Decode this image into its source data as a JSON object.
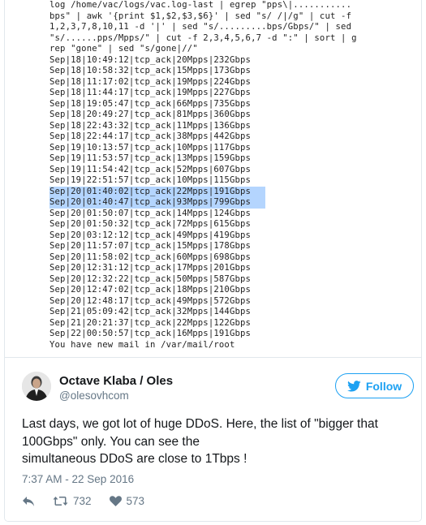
{
  "terminal": {
    "command_lines": [
      "log /home/vac/logs/vac.log-last | egrep \"pps\\|...........",
      "bps\" | awk '{print $1,$2,$3,$6}' | sed \"s/ /|/g\" | cut -f",
      "1,2,3,7,8,10,11 -d '|' | sed \"s/.........bps/Gbps/\" | sed",
      "\"s/......pps/Mpps/\" | cut -f 2,3,4,5,6,7 -d \":\" | sort | g",
      "rep \"gone\" | sed \"s/gone|//\""
    ],
    "rows": [
      {
        "text": "Sep|18|10:49:12|tcp_ack|20Mpps|232Gbps",
        "highlighted": false
      },
      {
        "text": "Sep|18|10:58:32|tcp_ack|15Mpps|173Gbps",
        "highlighted": false
      },
      {
        "text": "Sep|18|11:17:02|tcp_ack|19Mpps|224Gbps",
        "highlighted": false
      },
      {
        "text": "Sep|18|11:44:17|tcp_ack|19Mpps|227Gbps",
        "highlighted": false
      },
      {
        "text": "Sep|18|19:05:47|tcp_ack|66Mpps|735Gbps",
        "highlighted": false
      },
      {
        "text": "Sep|18|20:49:27|tcp_ack|81Mpps|360Gbps",
        "highlighted": false
      },
      {
        "text": "Sep|18|22:43:32|tcp_ack|11Mpps|136Gbps",
        "highlighted": false
      },
      {
        "text": "Sep|18|22:44:17|tcp_ack|38Mpps|442Gbps",
        "highlighted": false
      },
      {
        "text": "Sep|19|10:13:57|tcp_ack|10Mpps|117Gbps",
        "highlighted": false
      },
      {
        "text": "Sep|19|11:53:57|tcp_ack|13Mpps|159Gbps",
        "highlighted": false
      },
      {
        "text": "Sep|19|11:54:42|tcp_ack|52Mpps|607Gbps",
        "highlighted": false
      },
      {
        "text": "Sep|19|22:51:57|tcp_ack|10Mpps|115Gbps",
        "highlighted": false
      },
      {
        "text": "Sep|20|01:40:02|tcp_ack|22Mpps|191Gbps",
        "highlighted": true
      },
      {
        "text": "Sep|20|01:40:47|tcp_ack|93Mpps|799Gbps",
        "highlighted": true
      },
      {
        "text": "Sep|20|01:50:07|tcp_ack|14Mpps|124Gbps",
        "highlighted": false
      },
      {
        "text": "Sep|20|01:50:32|tcp_ack|72Mpps|615Gbps",
        "highlighted": false
      },
      {
        "text": "Sep|20|03:12:12|tcp_ack|49Mpps|419Gbps",
        "highlighted": false
      },
      {
        "text": "Sep|20|11:57:07|tcp_ack|15Mpps|178Gbps",
        "highlighted": false
      },
      {
        "text": "Sep|20|11:58:02|tcp_ack|60Mpps|698Gbps",
        "highlighted": false
      },
      {
        "text": "Sep|20|12:31:12|tcp_ack|17Mpps|201Gbps",
        "highlighted": false
      },
      {
        "text": "Sep|20|12:32:22|tcp_ack|50Mpps|587Gbps",
        "highlighted": false
      },
      {
        "text": "Sep|20|12:47:02|tcp_ack|18Mpps|210Gbps",
        "highlighted": false
      },
      {
        "text": "Sep|20|12:48:17|tcp_ack|49Mpps|572Gbps",
        "highlighted": false
      },
      {
        "text": "Sep|21|05:09:42|tcp_ack|32Mpps|144Gbps",
        "highlighted": false
      },
      {
        "text": "Sep|21|20:21:37|tcp_ack|22Mpps|122Gbps",
        "highlighted": false
      },
      {
        "text": "Sep|22|00:50:57|tcp_ack|16Mpps|191Gbps",
        "highlighted": false
      }
    ],
    "footer_line": "You have new mail in /var/mail/root",
    "highlight_color": "#b4d5fe"
  },
  "tweet": {
    "author_name": "Octave Klaba / Oles",
    "author_handle": "@olesovhcom",
    "follow_label": "Follow",
    "text_lines": [
      "Last days, we got lot of huge DDoS. Here, the list of \"bigger that",
      "100Gbps\" only. You can see the",
      "simultaneous DDoS are close to 1Tbps !"
    ],
    "timestamp": "7:37 AM - 22 Sep 2016",
    "retweet_count": "732",
    "like_count": "573",
    "icons": {
      "reply": "reply-icon",
      "retweet": "retweet-icon",
      "like": "heart-icon",
      "follow": "twitter-bird-icon"
    },
    "accent_color": "#1da1f2",
    "muted_color": "#657786"
  }
}
